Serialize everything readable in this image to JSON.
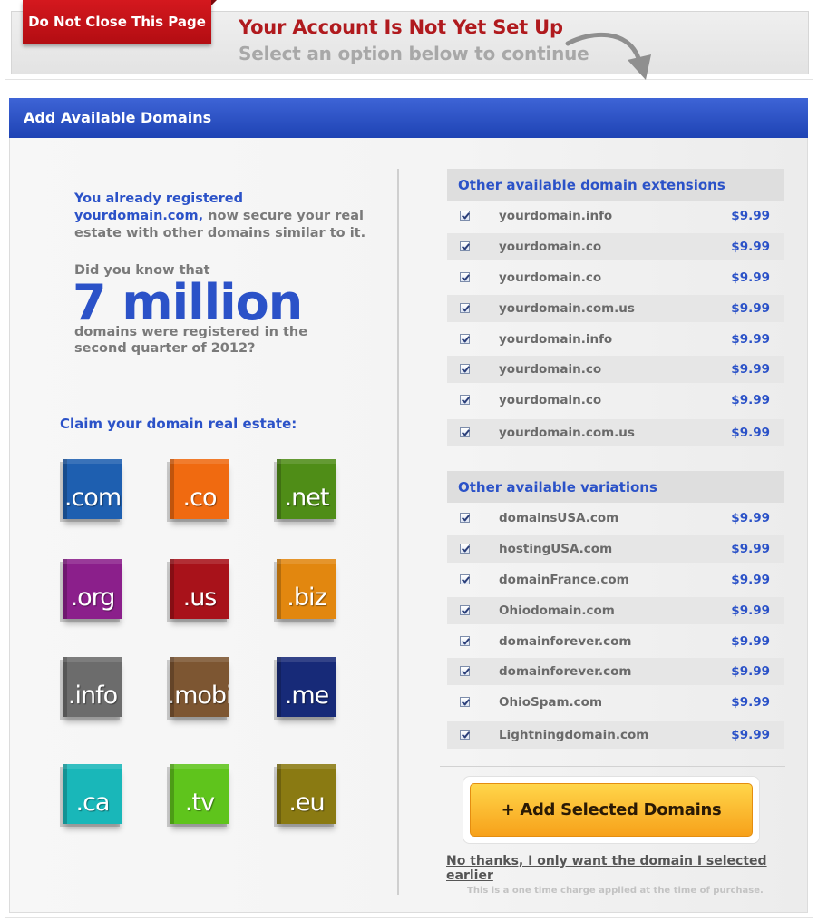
{
  "header": {
    "badge": "Do Not Close This Page",
    "title": "Your Account Is Not Yet Set Up",
    "subtitle": "Select an option below to continue"
  },
  "panel": {
    "title": "Add Available Domains"
  },
  "left": {
    "intro_lead": "You already registered yourdomain.com,",
    "intro_rest": " now secure your real estate with other domains similar to it.",
    "did_you_know": "Did you know that",
    "big_number": "7 million",
    "registered_text": "domains were registered in the second quarter of 2012?",
    "claim": "Claim your domain real estate:",
    "tiles": [
      {
        "label": ".com",
        "color": "#1e5fb0"
      },
      {
        "label": ".co",
        "color": "#f06a10"
      },
      {
        "label": ".net",
        "color": "#4f8d17"
      },
      {
        "label": ".org",
        "color": "#8b1f8b"
      },
      {
        "label": ".us",
        "color": "#a8121a"
      },
      {
        "label": ".biz",
        "color": "#e2870f"
      },
      {
        "label": ".info",
        "color": "#6c6c6c"
      },
      {
        "label": ".mobi",
        "color": "#7d5632"
      },
      {
        "label": ".me",
        "color": "#172a78"
      },
      {
        "label": ".ca",
        "color": "#19b7b9"
      },
      {
        "label": ".tv",
        "color": "#5fc41c"
      },
      {
        "label": ".eu",
        "color": "#8a7a12"
      }
    ]
  },
  "extensions": {
    "heading": "Other available domain extensions",
    "items": [
      {
        "name": "yourdomain.info",
        "price": "$9.99"
      },
      {
        "name": "yourdomain.co",
        "price": "$9.99"
      },
      {
        "name": "yourdomain.co",
        "price": "$9.99"
      },
      {
        "name": "yourdomain.com.us",
        "price": "$9.99"
      },
      {
        "name": "yourdomain.info",
        "price": "$9.99"
      },
      {
        "name": "yourdomain.co",
        "price": "$9.99"
      },
      {
        "name": "yourdomain.co",
        "price": "$9.99"
      },
      {
        "name": "yourdomain.com.us",
        "price": "$9.99"
      }
    ]
  },
  "variations": {
    "heading": "Other available variations",
    "items": [
      {
        "name": "domainsUSA.com",
        "price": "$9.99"
      },
      {
        "name": "hostingUSA.com",
        "price": "$9.99"
      },
      {
        "name": "domainFrance.com",
        "price": "$9.99"
      },
      {
        "name": "Ohiodomain.com",
        "price": "$9.99"
      },
      {
        "name": "domainforever.com",
        "price": "$9.99"
      },
      {
        "name": "domainforever.com",
        "price": "$9.99"
      },
      {
        "name": "OhioSpam.com",
        "price": "$9.99"
      },
      {
        "name": "Lightningdomain.com",
        "price": "$9.99"
      }
    ]
  },
  "actions": {
    "add_button": "+ Add Selected Domains",
    "decline_link": "No thanks, I only want the domain I selected earlier",
    "fine_print": "This is a one time charge applied at the time of purchase."
  }
}
